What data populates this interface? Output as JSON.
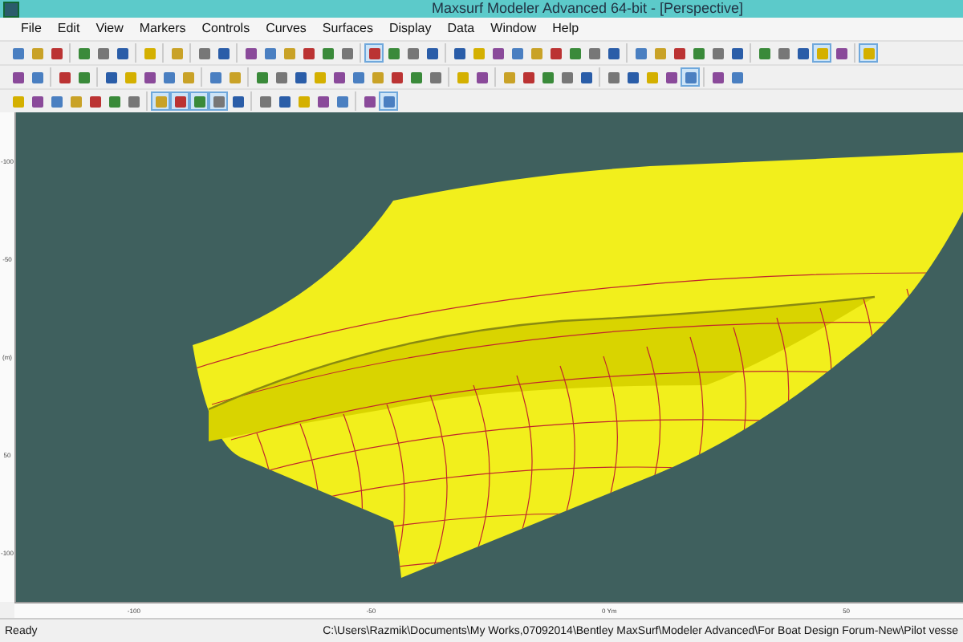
{
  "window": {
    "title": "Maxsurf Modeler Advanced 64-bit - [Perspective]"
  },
  "menu": [
    "File",
    "Edit",
    "View",
    "Markers",
    "Controls",
    "Curves",
    "Surfaces",
    "Display",
    "Data",
    "Window",
    "Help"
  ],
  "toolbars": [
    {
      "groups": [
        [
          false,
          false,
          false
        ],
        [
          false,
          false,
          false
        ],
        [
          false
        ],
        [
          false
        ],
        [
          false,
          false
        ],
        [
          false,
          false,
          false,
          false,
          false,
          false
        ],
        [
          true,
          false,
          false,
          false
        ],
        [
          false,
          false,
          false,
          false,
          false,
          false,
          false,
          false,
          false
        ],
        [
          false,
          false,
          false,
          false,
          false,
          false
        ],
        [
          false,
          false,
          false,
          true,
          false
        ],
        [
          true
        ]
      ]
    },
    {
      "groups": [
        [
          false,
          false
        ],
        [
          false,
          false
        ],
        [
          false,
          false,
          false,
          false,
          false
        ],
        [
          false,
          false
        ],
        [
          false,
          false,
          false,
          false,
          false,
          false,
          false,
          false,
          false,
          false
        ],
        [
          false,
          false
        ],
        [
          false,
          false,
          false,
          false,
          false
        ],
        [
          false,
          false,
          false,
          false,
          true
        ],
        [
          false,
          false
        ]
      ]
    },
    {
      "groups": [
        [
          false,
          false,
          false,
          false,
          false,
          false,
          false
        ],
        [
          true,
          true,
          true,
          true,
          false
        ],
        [
          false,
          false,
          false,
          false,
          false
        ],
        [
          false,
          true
        ]
      ]
    }
  ],
  "rulers": {
    "vertical": [
      "-100",
      "-50",
      "(m)",
      "50",
      "-100"
    ],
    "horizontal": [
      "-100",
      "-50",
      "0 Ym",
      "50"
    ]
  },
  "status_bar": {
    "state": "Ready",
    "path": "C:\\Users\\Razmik\\Documents\\My Works,07092014\\Bentley MaxSurf\\Modeler Advanced\\For Boat Design Forum-New\\Pilot vesse"
  }
}
